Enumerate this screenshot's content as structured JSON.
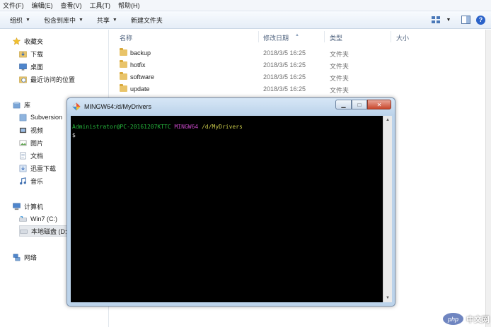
{
  "menu": [
    "文件(F)",
    "编辑(E)",
    "查看(V)",
    "工具(T)",
    "帮助(H)"
  ],
  "toolbar": {
    "organize": "组织",
    "include_in_library": "包含到库中",
    "share": "共享",
    "new_folder": "新建文件夹"
  },
  "nav": {
    "favorites": "收藏夹",
    "downloads": "下载",
    "desktop": "桌面",
    "recent": "最近访问的位置",
    "libraries": "库",
    "subversion": "Subversion",
    "videos": "视频",
    "pictures": "图片",
    "documents": "文档",
    "thunder": "迅雷下载",
    "music": "音乐",
    "computer": "计算机",
    "win7": "Win7 (C:)",
    "local_disk": "本地磁盘 (D:",
    "network": "网络"
  },
  "columns": {
    "name": "名称",
    "modified": "修改日期",
    "type": "类型",
    "size": "大小"
  },
  "files": [
    {
      "name": "backup",
      "date": "2018/3/5 16:25",
      "type": "文件夹"
    },
    {
      "name": "hotfix",
      "date": "2018/3/5 16:25",
      "type": "文件夹"
    },
    {
      "name": "software",
      "date": "2018/3/5 16:25",
      "type": "文件夹"
    },
    {
      "name": "update",
      "date": "2018/3/5 16:25",
      "type": "文件夹"
    }
  ],
  "terminal": {
    "title": "MINGW64:/d/MyDrivers",
    "user_host": "Administrator@PC-20161207KTTC",
    "env": "MINGW64",
    "path": "/d/MyDrivers",
    "prompt": "$"
  },
  "watermark": {
    "logo": "php",
    "text": "中文网"
  },
  "colors": {
    "terminal_bg": "#000000",
    "prompt_green": "#26b63d",
    "prompt_magenta": "#c447c4",
    "prompt_yellow": "#c9c94a",
    "folder": "#e9c46a"
  }
}
